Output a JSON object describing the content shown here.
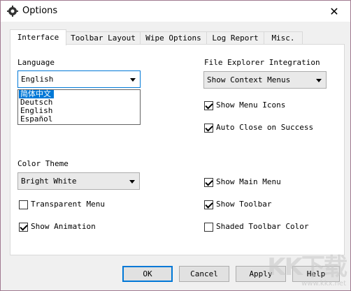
{
  "window": {
    "title": "Options",
    "close_glyph": "✕"
  },
  "tabs": [
    {
      "label": "Interface"
    },
    {
      "label": "Toolbar Layout"
    },
    {
      "label": "Wipe Options"
    },
    {
      "label": "Log Report"
    },
    {
      "label": "Misc."
    }
  ],
  "interface": {
    "language_label": "Language",
    "language_value": "English",
    "language_options": [
      "简体中文",
      "Deutsch",
      "English",
      "Español"
    ],
    "file_explorer_label": "File Explorer Integration",
    "file_explorer_value": "Show Context Menus",
    "show_menu_icons": {
      "label": "Show Menu Icons",
      "checked": true
    },
    "auto_close": {
      "label": "Auto Close on Success",
      "checked": true
    },
    "color_theme_label": "Color Theme",
    "color_theme_value": "Bright White",
    "transparent_menu": {
      "label": "Transparent Menu",
      "checked": false
    },
    "show_animation": {
      "label": "Show Animation",
      "checked": true
    },
    "show_main_menu": {
      "label": "Show Main Menu",
      "checked": true
    },
    "show_toolbar": {
      "label": "Show Toolbar",
      "checked": true
    },
    "shaded_toolbar": {
      "label": "Shaded Toolbar Color",
      "checked": false
    }
  },
  "buttons": {
    "ok": "OK",
    "cancel": "Cancel",
    "apply": "Apply",
    "help": "Help"
  },
  "watermark": {
    "logo": "KK下载",
    "url": "www.kkx.net"
  },
  "colors": {
    "accent": "#0078d7",
    "border": "#adadad"
  }
}
